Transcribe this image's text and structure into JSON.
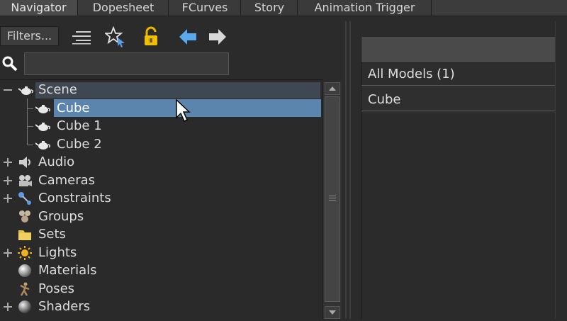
{
  "tabs": [
    {
      "label": "Navigator",
      "active": true
    },
    {
      "label": "Dopesheet",
      "active": false
    },
    {
      "label": "FCurves",
      "active": false
    },
    {
      "label": "Story",
      "active": false
    },
    {
      "label": "Animation Trigger",
      "active": false
    }
  ],
  "toolbar": {
    "filters_label": "Filters...",
    "icons": [
      "list-view-icon",
      "star-select-icon",
      "lock-icon",
      "arrow-left-icon",
      "arrow-right-icon"
    ]
  },
  "search": {
    "value": "",
    "placeholder": ""
  },
  "tree": {
    "scene": "Scene",
    "scene_children": [
      "Cube",
      "Cube 1",
      "Cube 2"
    ],
    "selected": "Cube",
    "categories": [
      {
        "label": "Audio",
        "icon": "audio-icon",
        "expandable": true
      },
      {
        "label": "Cameras",
        "icon": "camera-icon",
        "expandable": true
      },
      {
        "label": "Constraints",
        "icon": "constraint-icon",
        "expandable": true
      },
      {
        "label": "Groups",
        "icon": "groups-icon",
        "expandable": false
      },
      {
        "label": "Sets",
        "icon": "folder-icon",
        "expandable": false
      },
      {
        "label": "Lights",
        "icon": "light-icon",
        "expandable": true
      },
      {
        "label": "Materials",
        "icon": "material-sphere-icon",
        "expandable": false
      },
      {
        "label": "Poses",
        "icon": "pose-icon",
        "expandable": false
      },
      {
        "label": "Shaders",
        "icon": "shader-icon",
        "expandable": true
      }
    ]
  },
  "right_panel": {
    "header": "",
    "group_label": "All Models (1)",
    "items": [
      "Cube"
    ]
  },
  "colors": {
    "selection": "#5b85ad",
    "scene_highlight": "#3e4752",
    "background": "#2b2b2b"
  }
}
